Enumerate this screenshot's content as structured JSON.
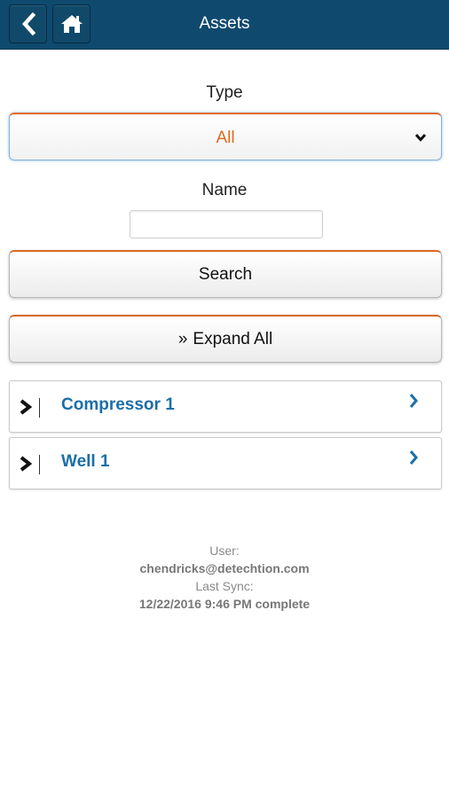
{
  "header": {
    "title": "Assets",
    "back_icon": "chevron-left-icon",
    "home_icon": "home-icon"
  },
  "filter": {
    "type_label": "Type",
    "type_value": "All",
    "name_label": "Name",
    "name_value": "",
    "search_label": "Search",
    "expand_glyph": "»",
    "expand_label": "Expand All"
  },
  "assets": [
    {
      "label": "Compressor 1"
    },
    {
      "label": "Well 1"
    }
  ],
  "footer": {
    "user_label": "User:",
    "user_value": "chendricks@detechtion.com",
    "sync_label": "Last Sync:",
    "sync_value": "12/22/2016 9:46 PM complete"
  },
  "colors": {
    "header_bg": "#0f4a6e",
    "accent_orange": "#e06a1e",
    "link_blue": "#1b6ea8"
  }
}
